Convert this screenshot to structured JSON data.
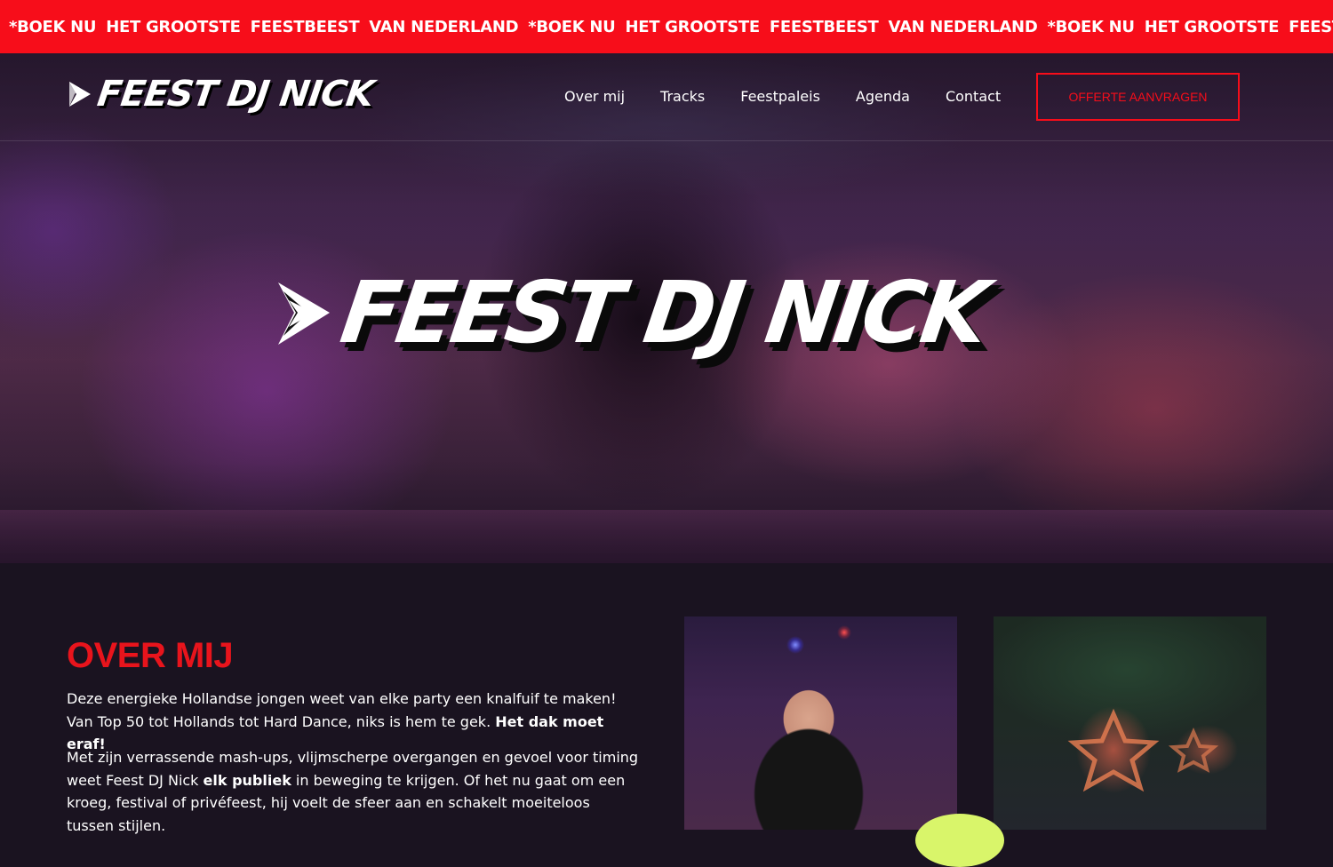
{
  "ticker": {
    "items": [
      "*BOEK NU",
      "HET GROOTSTE",
      "FEESTBEEST",
      "VAN NEDERLAND",
      "*BOEK NU",
      "HET GROOTSTE",
      "FEESTBEEST",
      "VAN NEDERLAND",
      "*BOEK NU",
      "HET GROOTSTE",
      "FEESTBEEST"
    ]
  },
  "header": {
    "logo_text": "FEEST DJ NICK",
    "nav": [
      {
        "label": "Over mij"
      },
      {
        "label": "Tracks"
      },
      {
        "label": "Feestpaleis"
      },
      {
        "label": "Agenda"
      },
      {
        "label": "Contact"
      }
    ],
    "cta_label": "OFFERTE AANVRAGEN"
  },
  "hero": {
    "logo_text": "FEEST DJ NICK"
  },
  "about": {
    "title": "OVER MIJ",
    "p1_a": "Deze energieke Hollandse jongen weet van elke party een knalfuif te maken! Van Top 50 tot Hollands tot Hard Dance, niks is hem te gek. ",
    "p1_b": "Het dak moet eraf!",
    "p2_a": "Met zijn verrassende mash-ups, vlijmscherpe overgangen en gevoel voor timing weet Feest DJ Nick ",
    "p2_b": "elk publiek",
    "p2_c": " in beweging te krijgen. Of het nu gaat om een kroeg, festival of privéfeest, hij voelt de sfeer aan en schakelt moeiteloos tussen stijlen."
  },
  "colors": {
    "brand_red": "#f70d1a",
    "background": "#1a1320",
    "accent_lime": "#d9f56a"
  }
}
